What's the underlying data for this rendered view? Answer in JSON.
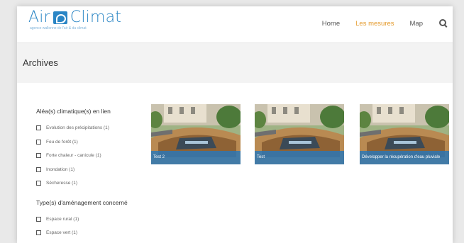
{
  "header": {
    "logo": {
      "word_left": "Air",
      "word_right": "Climat",
      "tagline": "agence wallonne de l'air & du climat",
      "color": "#2b86c5"
    },
    "nav": [
      {
        "label": "Home",
        "active": false
      },
      {
        "label": "Les mesures",
        "active": true
      },
      {
        "label": "Map",
        "active": false
      }
    ],
    "search_icon": "search-icon",
    "accent_color": "#e49a2c"
  },
  "page": {
    "title": "Archives"
  },
  "filters": [
    {
      "heading": "Aléa(s) climatique(s) en lien",
      "options": [
        {
          "label": "Evolution des précipitations (1)",
          "checked": false
        },
        {
          "label": "Feu de forêt (1)",
          "checked": false
        },
        {
          "label": "Forte chaleur - canicule (1)",
          "checked": false
        },
        {
          "label": "Inondation (1)",
          "checked": false
        },
        {
          "label": "Sécheresse (1)",
          "checked": false
        }
      ]
    },
    {
      "heading": "Type(s) d'aménagement concerné",
      "options": [
        {
          "label": "Espace rural (1)",
          "checked": false
        },
        {
          "label": "Espace vert (1)",
          "checked": false
        }
      ]
    }
  ],
  "cards": [
    {
      "caption": "Test 2"
    },
    {
      "caption": "Test"
    },
    {
      "caption": "Développer la récupération d'eau pluviale"
    }
  ]
}
